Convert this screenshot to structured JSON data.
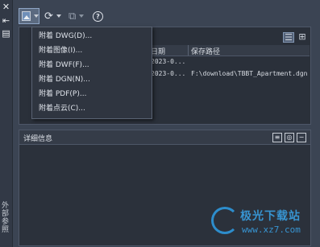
{
  "palette": {
    "title": "外部参照",
    "close_glyph": "✕",
    "pin_glyph": "⇤",
    "props_glyph": "▤"
  },
  "toolbar": {
    "refresh_glyph": "⟳",
    "change_path_glyph": "⧉",
    "help_glyph": "?"
  },
  "list": {
    "columns": [
      "日期",
      "保存路径"
    ],
    "rows": [
      {
        "date": "2023-0...",
        "path": ""
      },
      {
        "date": "2023-0...",
        "path": "F:\\download\\TBBT_Apartment.dgn"
      }
    ]
  },
  "detail": {
    "title": "详细信息"
  },
  "menu": {
    "items": [
      "附着 DWG(D)...",
      "附着图像(I)...",
      "附着 DWF(F)...",
      "附着 DGN(N)...",
      "附着 PDF(P)...",
      "附着点云(C)..."
    ]
  },
  "watermark": {
    "text": "极光下载站",
    "url": "www.xz7.com"
  },
  "colors": {
    "background": "#3b4453",
    "panel": "#2a303a",
    "accent": "#2e9ee6"
  }
}
